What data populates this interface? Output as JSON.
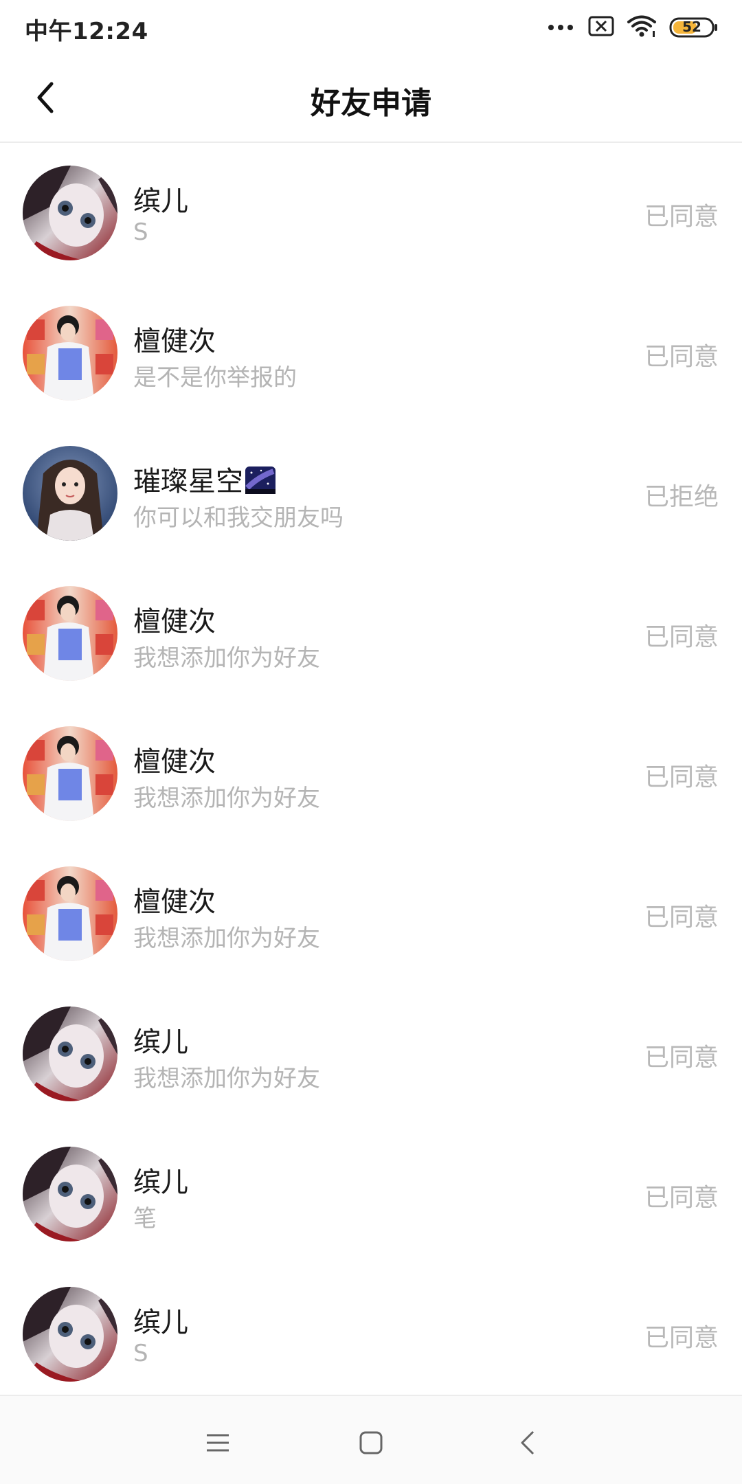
{
  "status_bar": {
    "time": "中午12:24",
    "battery": "52",
    "icons": [
      "more-dots-icon",
      "sim-off-icon",
      "wifi-icon",
      "battery-icon"
    ]
  },
  "header": {
    "title": "好友申请",
    "back_icon": "chevron-left-icon"
  },
  "requests": [
    {
      "name": "缤儿",
      "message": "S",
      "status": "已同意",
      "avatar": "anime-girl"
    },
    {
      "name": "檀健次",
      "message": "是不是你举报的",
      "status": "已同意",
      "avatar": "celebrity"
    },
    {
      "name": "璀璨星空",
      "emoji": "milky-way-emoji",
      "message": "你可以和我交朋友吗",
      "status": "已拒绝",
      "avatar": "portrait-girl"
    },
    {
      "name": "檀健次",
      "message": "我想添加你为好友",
      "status": "已同意",
      "avatar": "celebrity"
    },
    {
      "name": "檀健次",
      "message": "我想添加你为好友",
      "status": "已同意",
      "avatar": "celebrity"
    },
    {
      "name": "檀健次",
      "message": "我想添加你为好友",
      "status": "已同意",
      "avatar": "celebrity"
    },
    {
      "name": "缤儿",
      "message": "我想添加你为好友",
      "status": "已同意",
      "avatar": "anime-girl"
    },
    {
      "name": "缤儿",
      "message": "笔",
      "status": "已同意",
      "avatar": "anime-girl"
    },
    {
      "name": "缤儿",
      "message": "S",
      "status": "已同意",
      "avatar": "anime-girl"
    }
  ],
  "nav_bar": {
    "icons": [
      "menu-icon",
      "home-square-icon",
      "back-triangle-icon"
    ]
  },
  "colors": {
    "text_primary": "#1a1a1a",
    "text_secondary": "#b4b4b4",
    "divider": "#ececec",
    "battery_fill": "#f5b53a"
  }
}
